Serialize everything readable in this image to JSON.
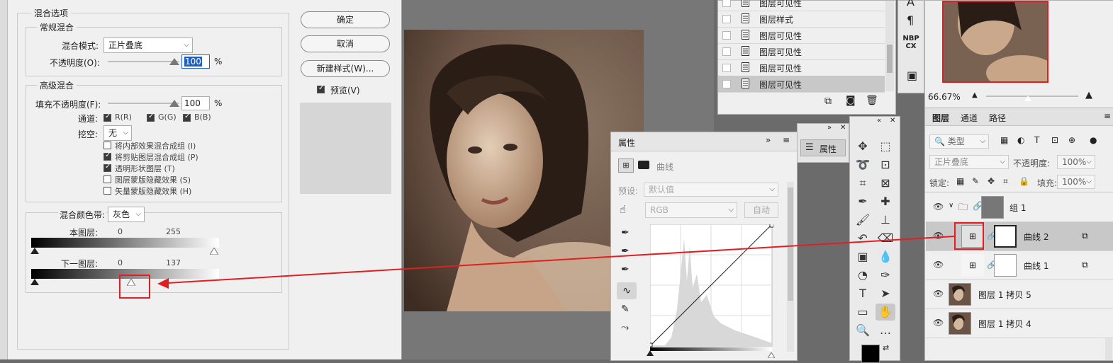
{
  "dialog": {
    "section_title": "混合选项",
    "general": {
      "title": "常规混合",
      "blend_mode_label": "混合模式:",
      "blend_mode_value": "正片叠底",
      "opacity_label": "不透明度(O):",
      "opacity_value": "100",
      "percent": "%"
    },
    "advanced": {
      "title": "高级混合",
      "fill_label": "填充不透明度(F):",
      "fill_value": "100",
      "percent": "%",
      "channels_label": "通道:",
      "ch_r": "R(R)",
      "ch_g": "G(G)",
      "ch_b": "B(B)",
      "knockout_label": "挖空:",
      "knockout_value": "无",
      "options": [
        {
          "label": "将内部效果混合成组 (I)",
          "checked": false
        },
        {
          "label": "将剪贴图层混合成组 (P)",
          "checked": true
        },
        {
          "label": "透明形状图层 (T)",
          "checked": true
        },
        {
          "label": "图层蒙版隐藏效果 (S)",
          "checked": false
        },
        {
          "label": "矢量蒙版隐藏效果 (H)",
          "checked": false
        }
      ]
    },
    "blendif": {
      "label": "混合颜色带:",
      "value": "灰色",
      "this_layer_label": "本图层:",
      "this_layer_low": "0",
      "this_layer_high": "255",
      "under_layer_label": "下一图层:",
      "under_layer_low": "0",
      "under_layer_high": "137",
      "under_layer_high_fraction": 0.537
    },
    "buttons": {
      "ok": "确定",
      "cancel": "取消",
      "new_style": "新建样式(W)...",
      "preview": "预览(V)"
    }
  },
  "history": {
    "items": [
      "图层可见性",
      "图层样式",
      "图层可见性",
      "图层可见性",
      "图层可见性",
      "图层可见性"
    ]
  },
  "properties": {
    "tab": "属性",
    "curves_label": "曲线",
    "preset_label": "预设:",
    "preset_value": "默认值",
    "channel_value": "RGB",
    "auto_button": "自动"
  },
  "mini_panel": {
    "label": "属性"
  },
  "right_strip": {
    "nbp_line1": "NBP",
    "nbp_line2": "CX"
  },
  "navigator": {
    "zoom": "66.67%"
  },
  "layers": {
    "tabs": [
      "图层",
      "通道",
      "路径"
    ],
    "filter_placeholder": "类型",
    "blend_mode": "正片叠底",
    "opacity_label": "不透明度:",
    "opacity_value": "100%",
    "lock_label": "锁定:",
    "fill_label": "填充:",
    "fill_value": "100%",
    "rows": [
      {
        "name": "组 1"
      },
      {
        "name": "曲线 2"
      },
      {
        "name": "曲线 1"
      },
      {
        "name": "图层 1 拷贝 5"
      },
      {
        "name": "图层 1 拷贝 4"
      }
    ]
  },
  "colors": {
    "accent_red": "#e02020",
    "panel_bg": "#efefef",
    "selected_row": "#c8c8c8"
  }
}
